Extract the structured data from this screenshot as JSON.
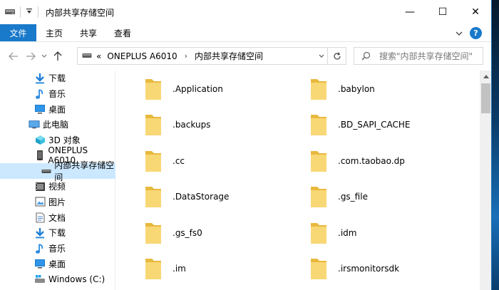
{
  "window": {
    "title": "内部共享存储空间",
    "controls": {
      "minimize": "—",
      "maximize": "☐",
      "close": "✕"
    }
  },
  "ribbon": {
    "tabs": [
      {
        "label": "文件"
      },
      {
        "label": "主页"
      },
      {
        "label": "共享"
      },
      {
        "label": "查看"
      }
    ],
    "help_label": "?"
  },
  "address": {
    "overflow": "«",
    "segments": [
      "ONEPLUS A6010",
      "内部共享存储空间"
    ],
    "separator": "›"
  },
  "search": {
    "placeholder": "搜索\"内部共享存储空间\""
  },
  "nav": {
    "items": [
      {
        "label": "下载",
        "icon": "download-arrow-icon"
      },
      {
        "label": "音乐",
        "icon": "music-note-icon"
      },
      {
        "label": "桌面",
        "icon": "desktop-icon"
      },
      {
        "label": "此电脑",
        "icon": "computer-icon"
      },
      {
        "label": "3D 对象",
        "icon": "3d-objects-icon"
      },
      {
        "label": "ONEPLUS A6010",
        "icon": "phone-icon"
      },
      {
        "label": "内部共享存储空间",
        "icon": "drive-icon",
        "selected": true
      },
      {
        "label": "视频",
        "icon": "video-icon"
      },
      {
        "label": "图片",
        "icon": "pictures-icon"
      },
      {
        "label": "文档",
        "icon": "documents-icon"
      },
      {
        "label": "下载",
        "icon": "download-arrow-icon"
      },
      {
        "label": "音乐",
        "icon": "music-note-icon"
      },
      {
        "label": "桌面",
        "icon": "desktop-icon"
      },
      {
        "label": "Windows (C:)",
        "icon": "windows-drive-icon"
      }
    ]
  },
  "files": [
    {
      "name": ".Application"
    },
    {
      "name": ".babylon"
    },
    {
      "name": ".backups"
    },
    {
      "name": ".BD_SAPI_CACHE"
    },
    {
      "name": ".cc"
    },
    {
      "name": ".com.taobao.dp"
    },
    {
      "name": ".DataStorage"
    },
    {
      "name": ".gs_file"
    },
    {
      "name": ".gs_fs0"
    },
    {
      "name": ".idm"
    },
    {
      "name": ".im"
    },
    {
      "name": ".irsmonitorsdk"
    }
  ],
  "colors": {
    "accent": "#1979ca",
    "folder": "#f8d775",
    "folder_dark": "#e8b93e",
    "selection": "#cce8ff"
  }
}
